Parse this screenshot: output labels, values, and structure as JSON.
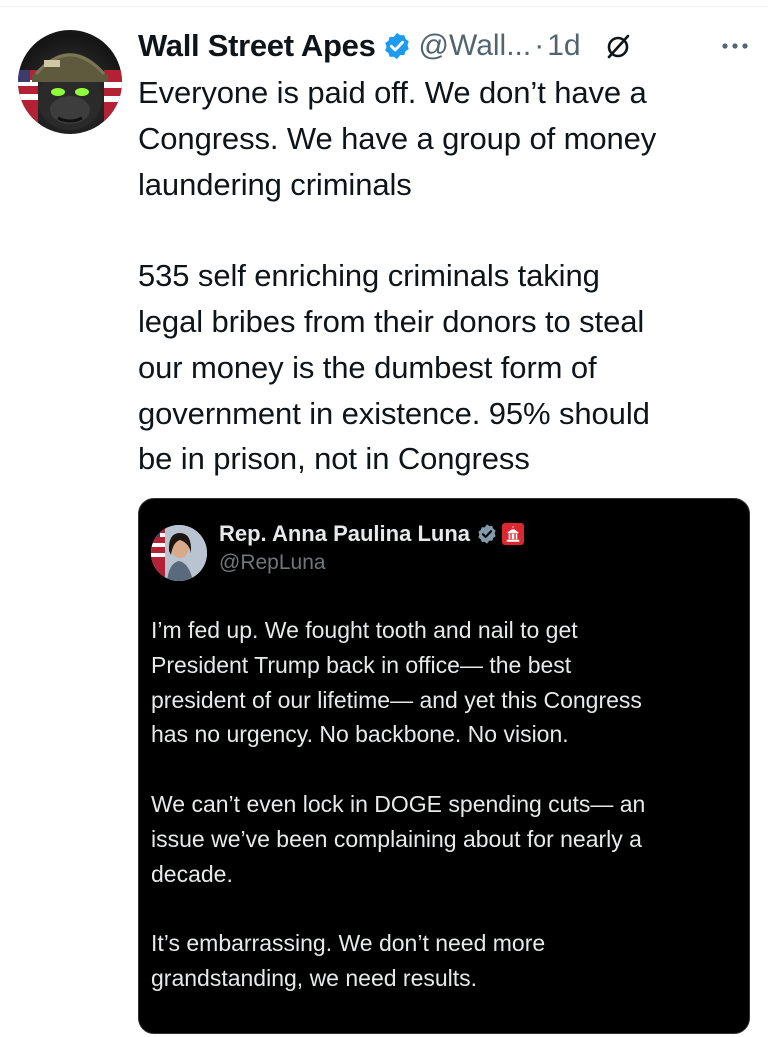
{
  "tweet": {
    "author_name": "Wall Street Apes",
    "handle": "@Wall...",
    "separator": "·",
    "time": "1d",
    "text": "Everyone is paid off. We don’t have a\nCongress. We have a group of money\nlaundering criminals\n\n535 self enriching criminals taking\nlegal bribes from their donors to steal\nour money is the dumbest form of\ngovernment in existence. 95% should\nbe in prison, not in Congress",
    "icons": {
      "avatar": "gorilla-helmet-avatar",
      "verified": "verified-badge-icon",
      "grok": "slash-circle-icon",
      "more": "more-dots-icon"
    }
  },
  "quote": {
    "author_name": "Rep. Anna Paulina Luna",
    "handle": "@RepLuna",
    "text": "I’m fed up. We fought tooth and nail to get\nPresident Trump back in office— the best\npresident of our lifetime— and yet this Congress\nhas no urgency. No backbone. No vision.\n\nWe can’t even lock in DOGE spending cuts— an\nissue we’ve been complaining about for nearly a\ndecade.\n\nIt’s embarrassing. We don’t need more\ngrandstanding, we need results.",
    "icons": {
      "avatar": "woman-portrait-avatar",
      "verified": "verified-badge-icon",
      "affiliation": "capitol-building-badge-icon"
    }
  },
  "colors": {
    "verified_blue": "#1d9bf0",
    "text_primary": "#0f1419",
    "text_secondary": "#536471",
    "quote_background": "#000000",
    "affiliation_red": "#d9282f"
  }
}
